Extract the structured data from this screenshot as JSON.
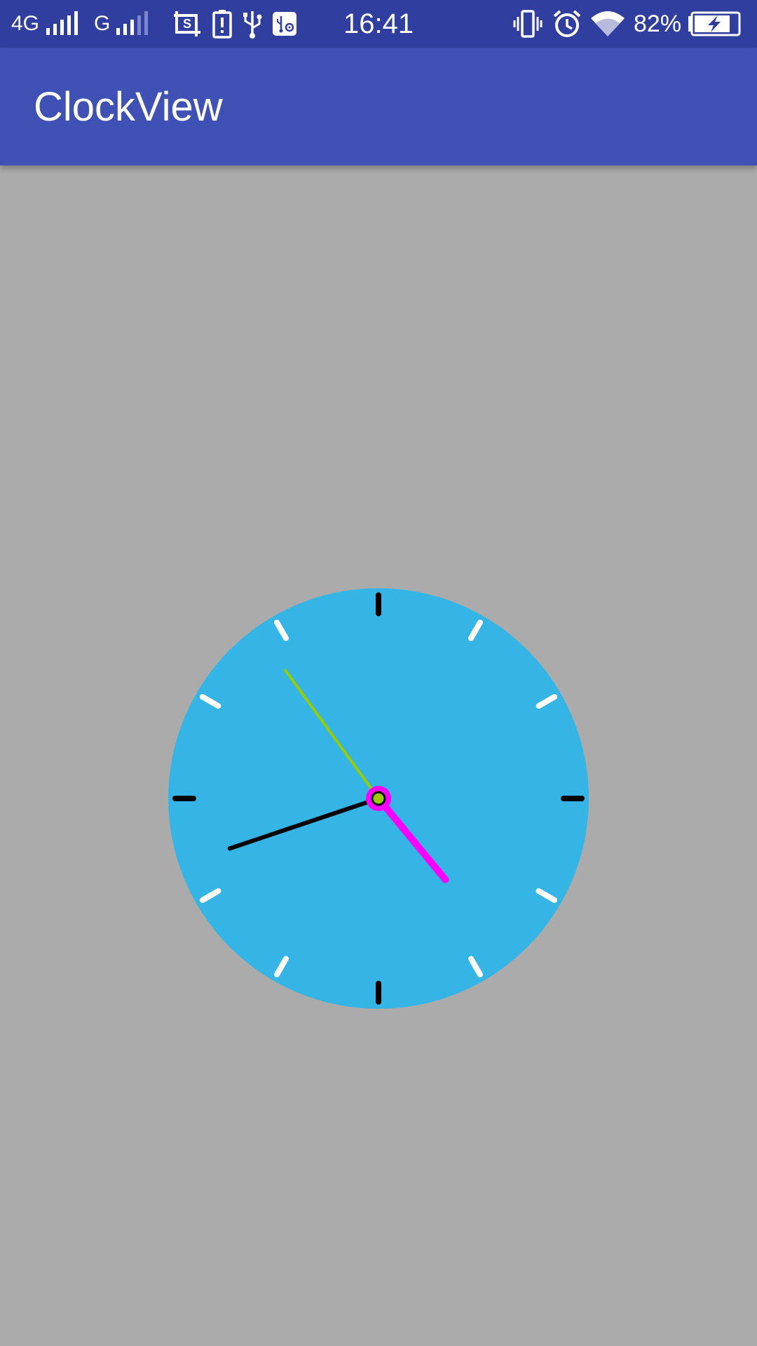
{
  "status_bar": {
    "network_1": "4G",
    "network_2": "G",
    "time": "16:41",
    "battery_percent": "82%",
    "battery_level": 0.82,
    "icons": [
      "signal-icon",
      "signal-icon",
      "screenshot-icon",
      "battery-alert-icon",
      "usb-icon",
      "usb-debug-icon",
      "vibrate-icon",
      "alarm-icon",
      "wifi-icon",
      "battery-charging-icon"
    ]
  },
  "app_bar": {
    "title": "ClockView"
  },
  "clock": {
    "time": {
      "hours": 4,
      "minutes": 41,
      "seconds": 54
    },
    "colors": {
      "face": "#35b5e5",
      "background": "#ababab",
      "hour_marks_major": "#000000",
      "hour_marks_minor": "#ffffff",
      "hour_hand": "#ff00ff",
      "minute_hand": "#000000",
      "second_hand": "#99cc00",
      "center_ring": "#ff00ff",
      "center_dot": "#99cc00"
    }
  },
  "colors": {
    "status_bar": "#303f9f",
    "app_bar": "#3f51b5"
  }
}
